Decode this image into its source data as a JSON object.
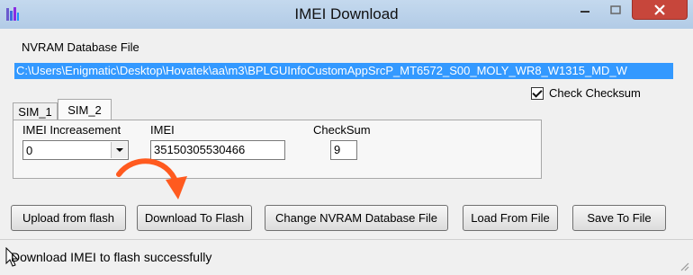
{
  "window": {
    "title": "IMEI Download"
  },
  "nvram": {
    "label": "NVRAM Database File",
    "path": "C:\\Users\\Enigmatic\\Desktop\\Hovatek\\aa\\m3\\BPLGUInfoCustomAppSrcP_MT6572_S00_MOLY_WR8_W1315_MD_W"
  },
  "check_checksum": {
    "label": "Check Checksum",
    "checked": true
  },
  "tabs": [
    {
      "label": "SIM_1"
    },
    {
      "label": "SIM_2",
      "active": true
    }
  ],
  "imei_panel": {
    "increasement_label": "IMEI Increasement",
    "increasement_value": "0",
    "imei_label": "IMEI",
    "imei_value": "35150305530466",
    "checksum_label": "CheckSum",
    "checksum_value": "9"
  },
  "buttons": {
    "upload": "Upload from flash",
    "download": "Download To Flash",
    "change": "Change NVRAM Database File",
    "load": "Load From File",
    "save": "Save To File"
  },
  "status": {
    "text": "Download IMEI to flash successfully"
  },
  "colors": {
    "titlebar": "#b9d1ea",
    "selection": "#3399ff",
    "close_button": "#c7463b",
    "annotation_arrow": "#ff5a1f"
  }
}
